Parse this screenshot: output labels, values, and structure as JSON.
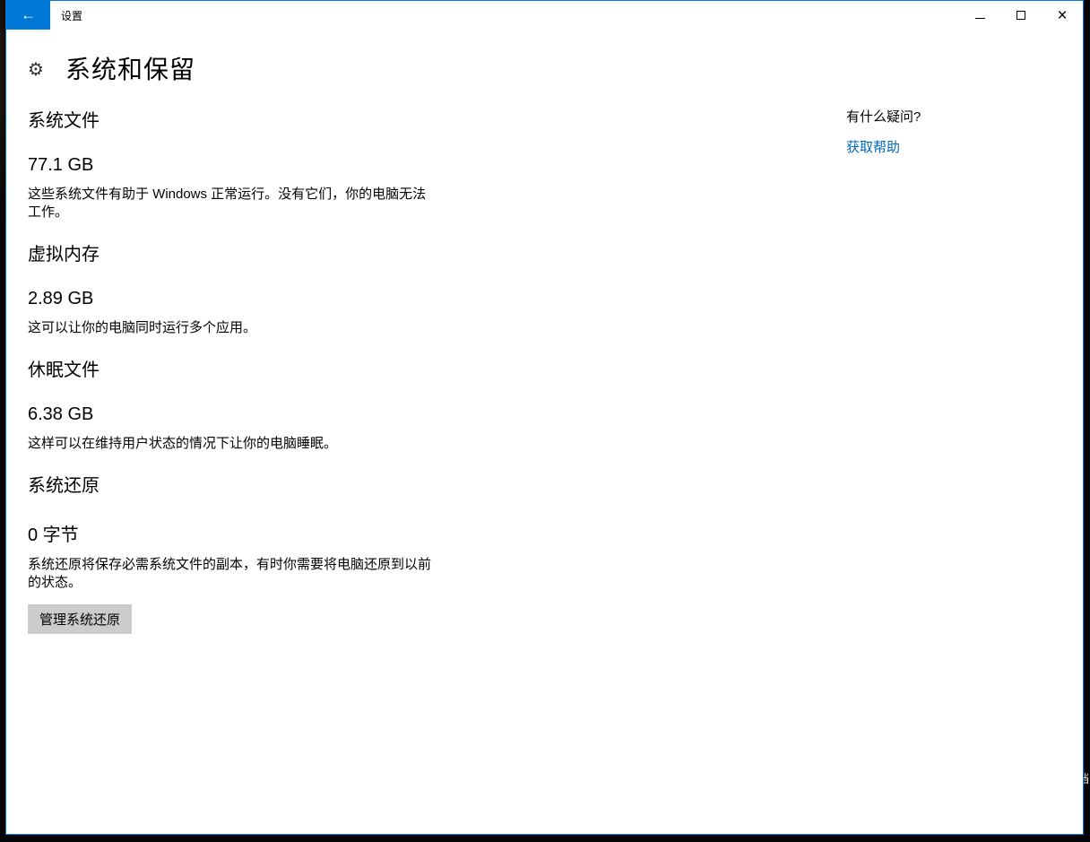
{
  "window": {
    "app_title": "设置",
    "back_glyph": "←",
    "close_glyph": "×"
  },
  "page": {
    "title": "系统和保留",
    "gear_glyph": "⚙",
    "sections": [
      {
        "heading": "系统文件",
        "value": "77.1 GB",
        "description": "这些系统文件有助于 Windows 正常运行。没有它们，你的电脑无法工作。"
      },
      {
        "heading": "虚拟内存",
        "value": "2.89 GB",
        "description": "这可以让你的电脑同时运行多个应用。"
      },
      {
        "heading": "休眠文件",
        "value": "6.38 GB",
        "description": "这样可以在维持用户状态的情况下让你的电脑睡眠。"
      },
      {
        "heading": "系统还原",
        "value": "0 字节",
        "description": "系统还原将保存必需系统文件的副本，有时你需要将电脑还原到以前的状态。",
        "button_label": "管理系统还原"
      }
    ],
    "help": {
      "question": "有什么疑问?",
      "link": "获取帮助"
    }
  },
  "colors": {
    "accent": "#0078d7",
    "link": "#0067b8",
    "button_bg": "#cccccc"
  }
}
